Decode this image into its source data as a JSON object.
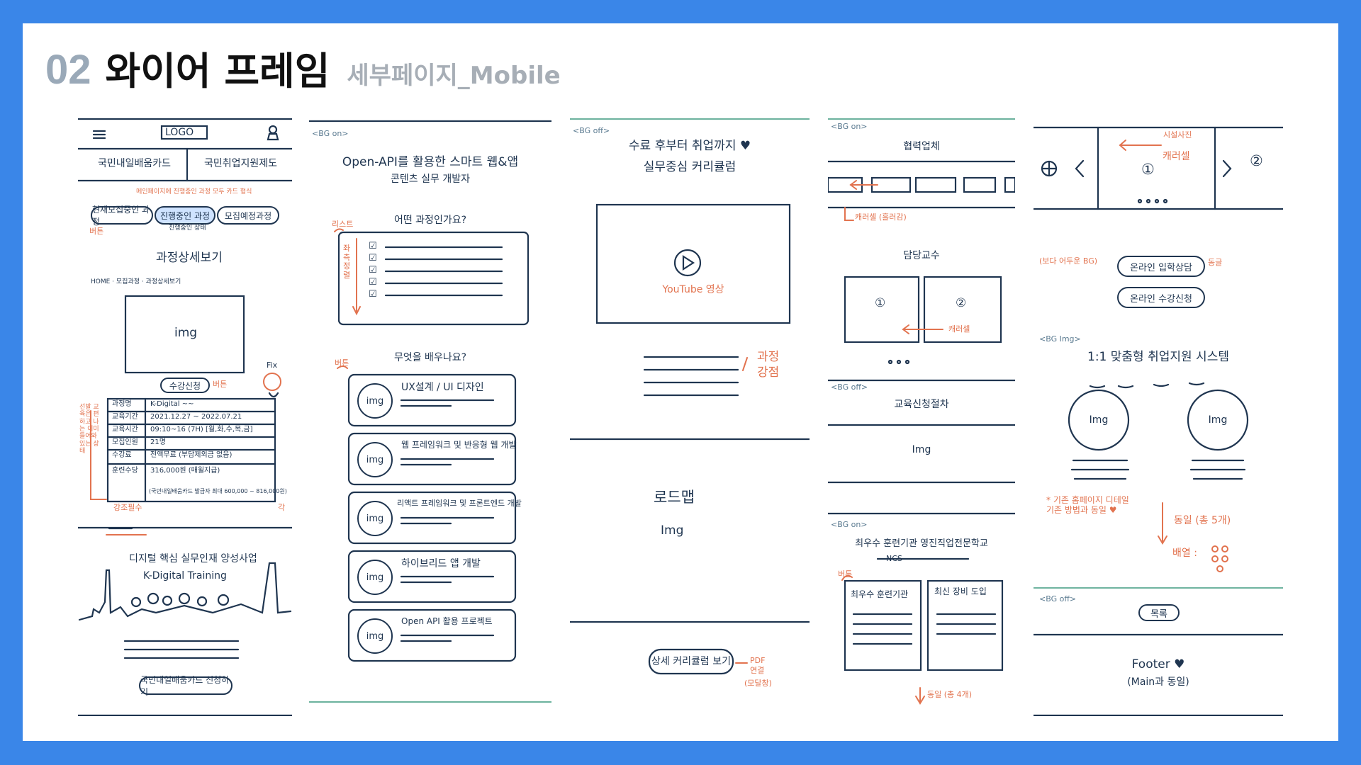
{
  "header": {
    "num": "02",
    "title": "와이어 프레임",
    "subtitle": "세부페이지_Mobile"
  },
  "p1": {
    "logo": "LOGO",
    "tabs": [
      "국민내일배움카드",
      "국민취업지원제도"
    ],
    "note_top": "메인페이지에 진행중인 과정 모두 카드 형식",
    "pills": [
      "현재모집중인 과정",
      "진행중인 과정",
      "모집예정과정"
    ],
    "pill_note": "진행중인 상태",
    "red_tag": "버튼",
    "section_title": "과정상세보기",
    "breadcrumb": "HOME · 모집과정 · 과정상세보기",
    "img": "img",
    "fix": "Fix",
    "apply_btn": "수강신청",
    "apply_note": "버튼",
    "side_note": "선발 교육은 편하고 나는 이미 들어와 있는 상태",
    "table": [
      {
        "k": "과정명",
        "v": "K-Digital ~~"
      },
      {
        "k": "교육기간",
        "v": "2021.12.27 ~ 2022.07.21"
      },
      {
        "k": "교육시간",
        "v": "09:10~16 (7H) [월,화,수,목,금]"
      },
      {
        "k": "모집인원",
        "v": "21명"
      },
      {
        "k": "수강료",
        "v": "전액무료 (부담제외금 없음)"
      },
      {
        "k": "훈련수당",
        "v": "316,000원 (매월지급)"
      }
    ],
    "table_foot": "(국민내일배움카드 발급자 최대 600,000 ~ 816,000원)",
    "red_foot": "강조필수",
    "red_corner": "각",
    "banner_title": "디지털 핵심 실무인재 양성사업",
    "banner_sub": "K-Digital Training",
    "bottom_btn": "국민내일배움카드 신청하기"
  },
  "p2": {
    "bg": "<BG on>",
    "title1": "Open-API를 활용한 스마트 웹&앱",
    "title2": "콘텐츠 실무 개발자",
    "q1": "어떤 과정인가요?",
    "red1": "리스트",
    "red_vert": "좌측 정렬",
    "q2": "무엇을 배우나요?",
    "red2": "버튼",
    "cards": [
      "UX설계 / UI 디자인",
      "웹 프레임워크 및 반응형 웹 개발",
      "리액트 프레임워크 및 프론트엔드 개발",
      "하이브리드 앱 개발",
      "Open API 활용 프로젝트"
    ],
    "img": "img"
  },
  "p3": {
    "bg": "<BG off>",
    "title1": "수료 후부터 취업까지 ♥",
    "title2": "실무중심 커리큘럼",
    "yt": "YouTube 영상",
    "red_note1": "과정",
    "red_note2": "강점",
    "roadmap": "로드맵",
    "img": "Img",
    "btn": "상세 커리큘럼 보기",
    "red_pdf": "PDF",
    "red_pdf2": "연결",
    "red_pdf3": "(모달창)"
  },
  "p4": {
    "bg1": "<BG on>",
    "partner": "협력업체",
    "carousel_note": "캐러셀 (흘러감)",
    "prof": "담당교수",
    "n1": "①",
    "n2": "②",
    "carousel2": "캐러셀",
    "bg2": "<BG off>",
    "proc": "교육신청절차",
    "img": "Img",
    "bg3": "<BG on>",
    "inst_title": "최우수 훈련기관 영진직업전문학교",
    "ncs": "NCS",
    "red_tag": "버튼",
    "box1": "최우수 훈련기관",
    "box2": "최신 장비 도입",
    "foot_red": "동일 (총 4개)"
  },
  "p5": {
    "slide_label": "시설사진",
    "carousel": "캐러셀",
    "n1": "①",
    "n2": "②",
    "bg_note": "(보다 어두운 BG)",
    "btn1": "온라인 입학상담",
    "btn1_red": "동글",
    "btn2": "온라인 수강신청",
    "bg_img": "<BG Img>",
    "sys_title": "1:1 맞춤형 취업지원 시스템",
    "img": "Img",
    "note_red": "* 기존 홈페이지 디테일 기존 방법과 동일 ♥",
    "same_red": "동일 (총 5개)",
    "layout_red": "배열 :",
    "bg_off": "<BG off>",
    "list_btn": "목록",
    "footer1": "Footer ♥",
    "footer2": "(Main과 동일)"
  }
}
